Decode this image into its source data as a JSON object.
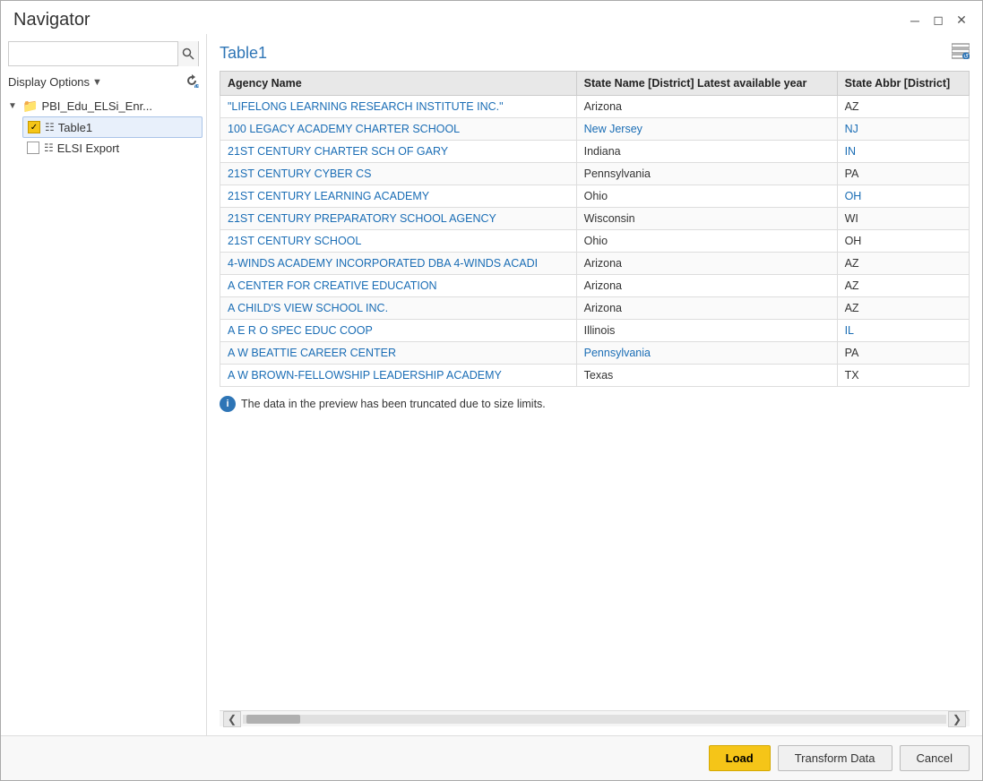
{
  "window": {
    "title": "Navigator",
    "minimize_label": "minimize",
    "restore_label": "restore",
    "close_label": "close"
  },
  "left_panel": {
    "search_placeholder": "",
    "display_options_label": "Display Options",
    "tree": {
      "root": {
        "label": "PBI_Edu_ELSi_Enr...",
        "children": [
          {
            "label": "Table1",
            "type": "table",
            "checked": true
          },
          {
            "label": "ELSI Export",
            "type": "table",
            "checked": false
          }
        ]
      }
    }
  },
  "right_panel": {
    "table_title": "Table1",
    "columns": [
      "Agency Name",
      "State Name [District] Latest available year",
      "State Abbr [District]"
    ],
    "rows": [
      {
        "agency": "\"LIFELONG LEARNING RESEARCH INSTITUTE INC.\"",
        "state_name": "Arizona",
        "state_abbr": "AZ",
        "name_is_link": true,
        "state_link": false,
        "abbr_link": false
      },
      {
        "agency": "100 LEGACY ACADEMY CHARTER SCHOOL",
        "state_name": "New Jersey",
        "state_abbr": "NJ",
        "name_is_link": true,
        "state_link": true,
        "abbr_link": true
      },
      {
        "agency": "21ST CENTURY CHARTER SCH OF GARY",
        "state_name": "Indiana",
        "state_abbr": "IN",
        "name_is_link": true,
        "state_link": false,
        "abbr_link": true
      },
      {
        "agency": "21ST CENTURY CYBER CS",
        "state_name": "Pennsylvania",
        "state_abbr": "PA",
        "name_is_link": true,
        "state_link": false,
        "abbr_link": false
      },
      {
        "agency": "21ST CENTURY LEARNING ACADEMY",
        "state_name": "Ohio",
        "state_abbr": "OH",
        "name_is_link": true,
        "state_link": false,
        "abbr_link": true
      },
      {
        "agency": "21ST CENTURY PREPARATORY SCHOOL AGENCY",
        "state_name": "Wisconsin",
        "state_abbr": "WI",
        "name_is_link": true,
        "state_link": false,
        "abbr_link": false
      },
      {
        "agency": "21ST CENTURY SCHOOL",
        "state_name": "Ohio",
        "state_abbr": "OH",
        "name_is_link": true,
        "state_link": false,
        "abbr_link": false
      },
      {
        "agency": "4-WINDS ACADEMY INCORPORATED DBA 4-WINDS ACADI",
        "state_name": "Arizona",
        "state_abbr": "AZ",
        "name_is_link": true,
        "state_link": false,
        "abbr_link": false
      },
      {
        "agency": "A CENTER FOR CREATIVE EDUCATION",
        "state_name": "Arizona",
        "state_abbr": "AZ",
        "name_is_link": true,
        "state_link": false,
        "abbr_link": false
      },
      {
        "agency": "A CHILD'S VIEW SCHOOL INC.",
        "state_name": "Arizona",
        "state_abbr": "AZ",
        "name_is_link": true,
        "state_link": false,
        "abbr_link": false
      },
      {
        "agency": "A E R O SPEC EDUC COOP",
        "state_name": "Illinois",
        "state_abbr": "IL",
        "name_is_link": true,
        "state_link": false,
        "abbr_link": true
      },
      {
        "agency": "A W BEATTIE CAREER CENTER",
        "state_name": "Pennsylvania",
        "state_abbr": "PA",
        "name_is_link": true,
        "state_link": true,
        "abbr_link": false
      },
      {
        "agency": "A W BROWN-FELLOWSHIP LEADERSHIP ACADEMY",
        "state_name": "Texas",
        "state_abbr": "TX",
        "name_is_link": true,
        "state_link": false,
        "abbr_link": false
      }
    ],
    "truncate_notice": "The data in the preview has been truncated due to size limits."
  },
  "footer": {
    "load_label": "Load",
    "transform_label": "Transform Data",
    "cancel_label": "Cancel"
  }
}
